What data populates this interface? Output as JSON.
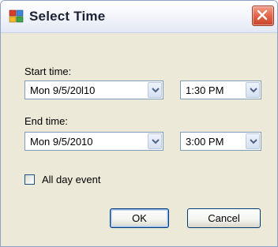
{
  "window": {
    "title": "Select Time",
    "close_icon": "close-icon"
  },
  "start": {
    "label": "Start time:",
    "date_value": "Mon 9/5/20l10",
    "time_value": "1:30 PM"
  },
  "end": {
    "label": "End time:",
    "date_value": "Mon 9/5/2010",
    "time_value": "3:00 PM"
  },
  "all_day": {
    "label": "All day event",
    "checked": false
  },
  "buttons": {
    "ok_label": "OK",
    "cancel_label": "Cancel"
  },
  "icons": [
    "app-icon",
    "close-icon",
    "chevron-down-icon"
  ],
  "colors": {
    "dialog_bg": "#ece9d8",
    "titlebar_bg": "#f4f6fb",
    "close_button": "#e1654a",
    "input_border": "#7f9db9",
    "button_border": "#003c74"
  }
}
